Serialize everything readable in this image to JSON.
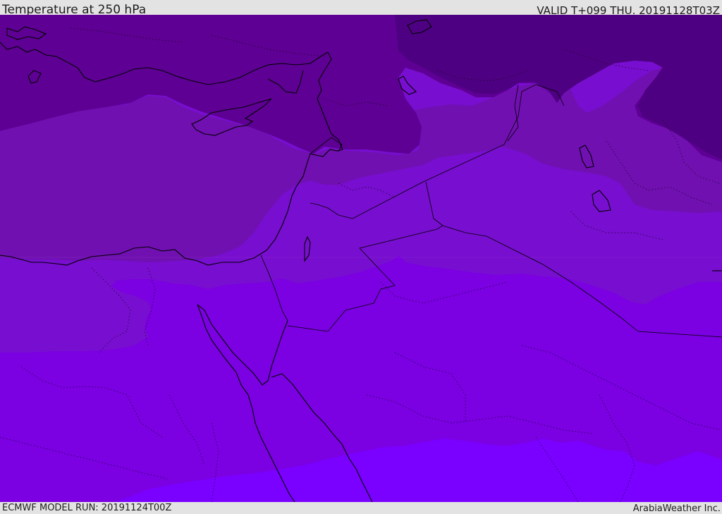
{
  "header": {
    "title": "Temperature at 250 hPa",
    "valid": "VALID T+099 THU. 20191128T03Z"
  },
  "footer": {
    "model_run": "ECMWF MODEL RUN: 20191124T00Z",
    "credit": "ArabiaWeather Inc."
  },
  "map": {
    "field": "temperature",
    "level": "250 hPa",
    "region": "Eastern Mediterranean and Middle East",
    "colors": {
      "band_coldest": "#4e0082",
      "band_2": "#5e0094",
      "band_3": "#7010b0",
      "band_4": "#780ecf",
      "band_5": "#7b00e2",
      "band_warmest": "#7a00ff",
      "coastline": "#000000",
      "border": "#000000"
    }
  }
}
